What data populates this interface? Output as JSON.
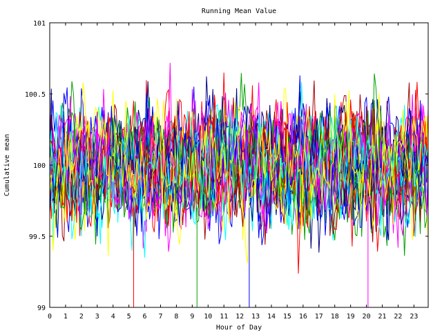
{
  "chart_data": {
    "type": "line",
    "title": "Running Mean Value",
    "xlabel": "Hour of Day",
    "ylabel": "Cumulative mean",
    "xlim": [
      0,
      23.9
    ],
    "ylim": [
      99,
      101
    ],
    "x_ticks": [
      0,
      1,
      2,
      3,
      4,
      5,
      6,
      7,
      8,
      9,
      10,
      11,
      12,
      13,
      14,
      15,
      16,
      17,
      18,
      19,
      20,
      21,
      22,
      23
    ],
    "y_ticks": [
      99,
      99.5,
      100,
      100.5,
      101
    ],
    "grid": false,
    "legend": "none",
    "x_step": 0.1,
    "series_count": 30,
    "series_colors": [
      "#ff0000",
      "#00a000",
      "#0000ff",
      "#ff00ff",
      "#00ffff",
      "#ffff00",
      "#a00000",
      "#000080"
    ],
    "series_style": "overlapping noisy random-walk traces fluctuating around 100 (mostly 99.5–100.5)",
    "spikes": [
      {
        "x": 5.3,
        "y": 99.0
      },
      {
        "x": 9.3,
        "y": 99.0
      },
      {
        "x": 12.6,
        "y": 99.0
      },
      {
        "x": 20.1,
        "y": 99.0
      }
    ]
  }
}
